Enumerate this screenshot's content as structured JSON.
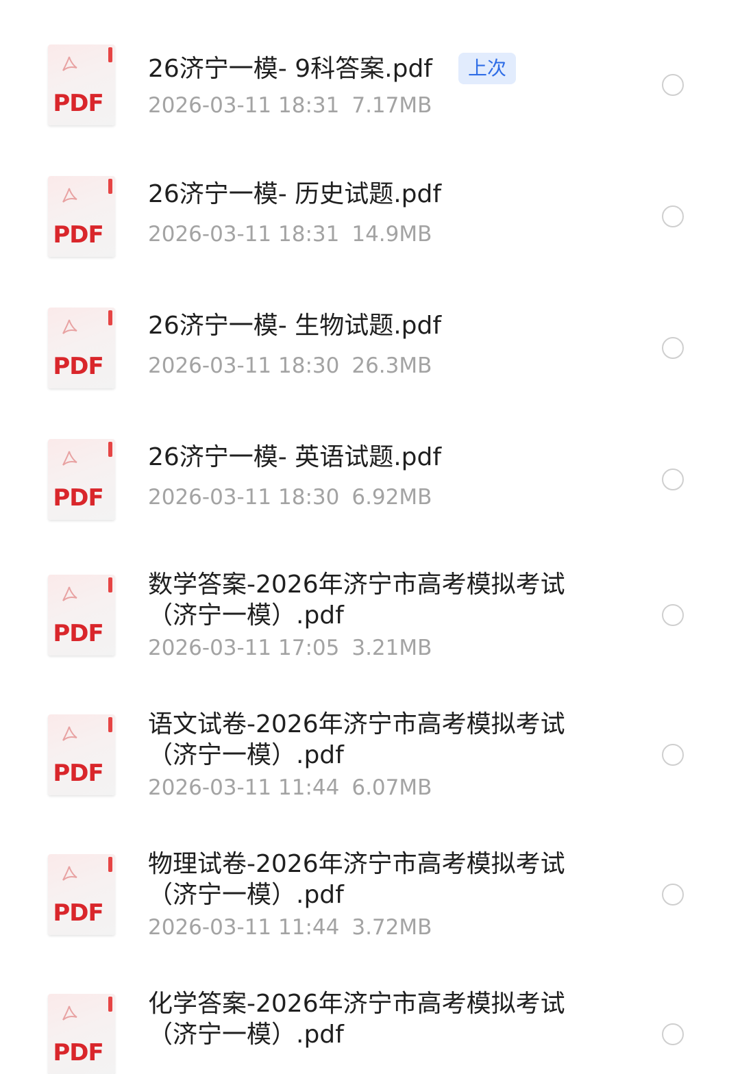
{
  "files": [
    {
      "name": "26济宁一模- 9科答案.pdf",
      "date": "2026-03-11 18:31",
      "size": "7.17MB",
      "badge": "上次"
    },
    {
      "name": "26济宁一模- 历史试题.pdf",
      "date": "2026-03-11 18:31",
      "size": "14.9MB"
    },
    {
      "name": "26济宁一模- 生物试题.pdf",
      "date": "2026-03-11 18:30",
      "size": "26.3MB"
    },
    {
      "name": "26济宁一模- 英语试题.pdf",
      "date": "2026-03-11 18:30",
      "size": "6.92MB"
    },
    {
      "name": "数学答案-2026年济宁市高考模拟考试（济宁一模）.pdf",
      "date": "2026-03-11 17:05",
      "size": "3.21MB"
    },
    {
      "name": "语文试卷-2026年济宁市高考模拟考试（济宁一模）.pdf",
      "date": "2026-03-11 11:44",
      "size": "6.07MB"
    },
    {
      "name": "物理试卷-2026年济宁市高考模拟考试（济宁一模）.pdf",
      "date": "2026-03-11 11:44",
      "size": "3.72MB"
    },
    {
      "name": "化学答案-2026年济宁市高考模拟考试（济宁一模）.pdf"
    }
  ],
  "file_icon": {
    "label": "PDF",
    "icon": "pdf-file-icon",
    "color": "#d9262b"
  },
  "colors": {
    "badge_bg": "#e2ecfd",
    "badge_text": "#2f6de6",
    "meta_text": "#a3a3a3"
  }
}
